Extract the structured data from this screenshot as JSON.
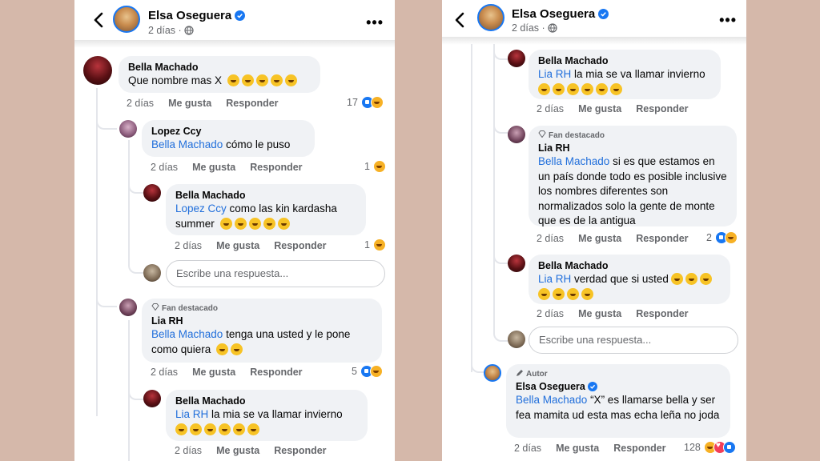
{
  "left_panel": {
    "header": {
      "name": "Elsa Oseguera",
      "time": "2 días",
      "more": "•••"
    },
    "comments": {
      "c1": {
        "name": "Bella Machado",
        "text": "Que nombre mas X",
        "emoji_count": 5,
        "time": "2 días",
        "like": "Me gusta",
        "reply": "Responder",
        "count": "17"
      },
      "c2": {
        "name": "Lopez Ccy",
        "mention": "Bella Machado",
        "text": " cómo le puso",
        "time": "2 días",
        "like": "Me gusta",
        "reply": "Responder",
        "count": "1"
      },
      "c3": {
        "name": "Bella Machado",
        "mention": "Lopez Ccy",
        "text": " como las kin kardasha summer",
        "time": "2 días",
        "like": "Me gusta",
        "reply": "Responder",
        "count": "1"
      },
      "reply_box": "Escribe una respuesta...",
      "c4": {
        "badge": "Fan destacado",
        "name": "Lia RH",
        "mention": "Bella Machado",
        "text": " tenga una usted y le pone como quiera",
        "time": "2 días",
        "like": "Me gusta",
        "reply": "Responder",
        "count": "5"
      },
      "c5": {
        "name": "Bella Machado",
        "mention": "Lia RH",
        "text": " la mia se va llamar invierno",
        "time": "2 días",
        "like": "Me gusta",
        "reply": "Responder"
      }
    }
  },
  "right_panel": {
    "header": {
      "name": "Elsa Oseguera",
      "time": "2 días",
      "more": "•••"
    },
    "comments": {
      "c1": {
        "name": "Bella Machado",
        "mention": "Lia RH",
        "text": " la mia se va llamar invierno",
        "time": "2 días",
        "like": "Me gusta",
        "reply": "Responder"
      },
      "c2": {
        "badge": "Fan destacado",
        "name": "Lia RH",
        "mention": "Bella Machado",
        "text": " si es que estamos en un país donde todo es posible inclusive los nombres diferentes son normalizados solo la gente de monte que es de la antigua",
        "time": "2 días",
        "like": "Me gusta",
        "reply": "Responder",
        "count": "2"
      },
      "c3": {
        "name": "Bella Machado",
        "mention": "Lia RH",
        "text": " verdad que si usted",
        "time": "2 días",
        "like": "Me gusta",
        "reply": "Responder"
      },
      "reply_box": "Escribe una respuesta...",
      "c4": {
        "badge": "Autor",
        "name": "Elsa Oseguera",
        "mention": "Bella Machado",
        "text": " “X” es llamarse bella y ser fea mamita ud esta mas echa leña no joda",
        "time": "2 días",
        "like": "Me gusta",
        "reply": "Responder",
        "count": "128"
      }
    }
  },
  "colors": {
    "accent": "#1877f2",
    "mention": "#216fdb",
    "bubble": "#f0f2f5",
    "background": "#d5b8aa"
  },
  "icons": [
    "back-arrow-icon",
    "verified-icon",
    "globe-icon",
    "more-icon",
    "like-reaction-icon",
    "haha-reaction-icon",
    "love-reaction-icon",
    "fan-badge-icon",
    "author-pen-icon",
    "laughing-emoji-icon"
  ]
}
